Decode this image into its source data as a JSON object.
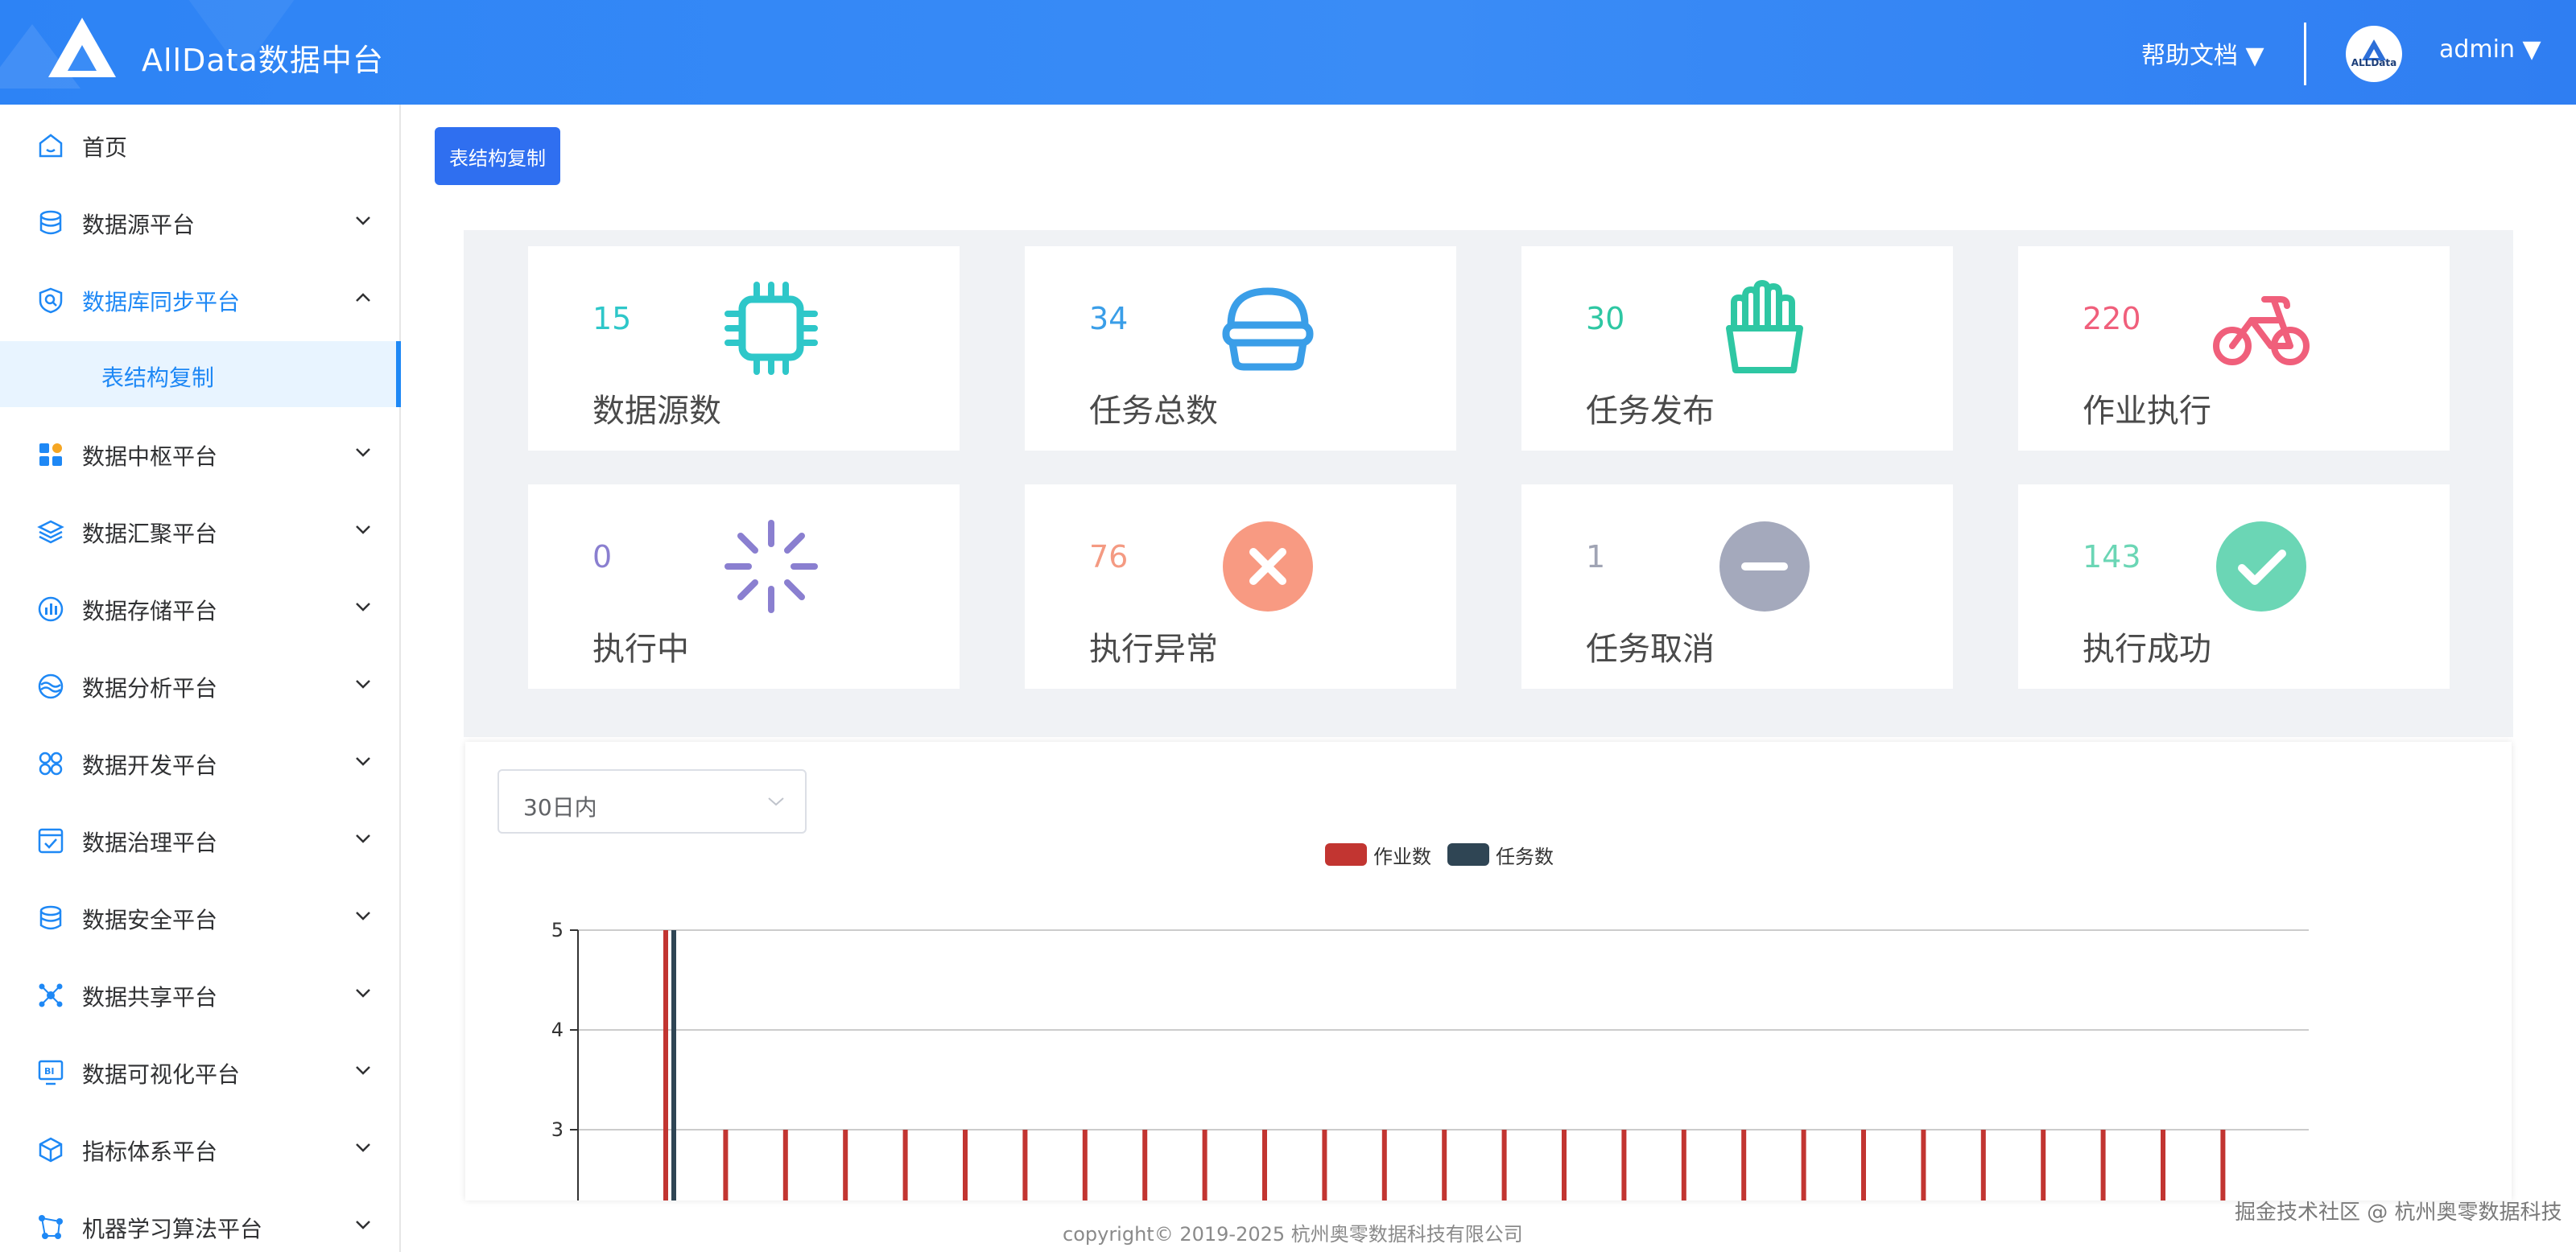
{
  "header": {
    "title": "AllData数据中台",
    "help": "帮助文档 ▼",
    "avatar_text": "ALLData",
    "user": "admin ▼"
  },
  "sidebar": {
    "items": [
      {
        "label": "首页",
        "icon": "home-icon",
        "expandable": false
      },
      {
        "label": "数据源平台",
        "icon": "database-icon",
        "expandable": true
      },
      {
        "label": "数据库同步平台",
        "icon": "sync-search-icon",
        "expandable": true,
        "expanded": true
      },
      {
        "label": "数据中枢平台",
        "icon": "grid-icon",
        "expandable": true
      },
      {
        "label": "数据汇聚平台",
        "icon": "layers-icon",
        "expandable": true
      },
      {
        "label": "数据存储平台",
        "icon": "storage-chart-icon",
        "expandable": true
      },
      {
        "label": "数据分析平台",
        "icon": "wave-icon",
        "expandable": true
      },
      {
        "label": "数据开发平台",
        "icon": "dev-circles-icon",
        "expandable": true
      },
      {
        "label": "数据治理平台",
        "icon": "governance-icon",
        "expandable": true
      },
      {
        "label": "数据安全平台",
        "icon": "security-db-icon",
        "expandable": true
      },
      {
        "label": "数据共享平台",
        "icon": "share-icon",
        "expandable": true
      },
      {
        "label": "数据可视化平台",
        "icon": "bi-monitor-icon",
        "expandable": true
      },
      {
        "label": "指标体系平台",
        "icon": "cube-icon",
        "expandable": true
      },
      {
        "label": "机器学习算法平台",
        "icon": "ml-nodes-icon",
        "expandable": true
      }
    ],
    "sub_item": "表结构复制"
  },
  "main": {
    "copy_button": "表结构复制",
    "stats": [
      {
        "value": "15",
        "label": "数据源数",
        "color": "#2ec7c9",
        "icon": "chip-icon"
      },
      {
        "value": "34",
        "label": "任务总数",
        "color": "#3a9ee8",
        "icon": "burger-icon"
      },
      {
        "value": "30",
        "label": "任务发布",
        "color": "#2ec7a3",
        "icon": "fries-icon"
      },
      {
        "value": "220",
        "label": "作业执行",
        "color": "#f05f7b",
        "icon": "bicycle-icon"
      },
      {
        "value": "0",
        "label": "执行中",
        "color": "#8a7fd0",
        "icon": "loading-icon"
      },
      {
        "value": "76",
        "label": "执行异常",
        "color": "#f49a82",
        "icon": "error-icon"
      },
      {
        "value": "1",
        "label": "任务取消",
        "color": "#a0a4b4",
        "icon": "minus-circle-icon"
      },
      {
        "value": "143",
        "label": "执行成功",
        "color": "#6bd6b5",
        "icon": "check-circle-icon"
      }
    ],
    "range_select": "30日内"
  },
  "chart_data": {
    "type": "bar",
    "legend": [
      "作业数",
      "任务数"
    ],
    "colors": [
      "#c23531",
      "#2f4554"
    ],
    "yticks": [
      "3",
      "4",
      "5"
    ],
    "ylim": [
      0,
      5
    ],
    "series": [
      {
        "name": "作业数",
        "values": [
          5,
          3,
          3,
          3,
          3,
          3,
          3,
          3,
          3,
          3,
          3,
          3,
          3,
          3,
          3,
          3,
          3,
          3,
          3,
          3,
          3,
          3,
          3,
          3,
          3,
          3,
          3
        ]
      },
      {
        "name": "任务数",
        "values": [
          5,
          0,
          0,
          0,
          0,
          0,
          0,
          0,
          0,
          0,
          0,
          0,
          0,
          0,
          0,
          0,
          0,
          0,
          0,
          0,
          0,
          0,
          0,
          0,
          0,
          0,
          0
        ]
      }
    ],
    "grid": true,
    "legend_position": "top-center"
  },
  "footer": "copyright© 2019-2025 杭州奥零数据科技有限公司",
  "watermark": "掘金技术社区 @ 杭州奥零数据科技"
}
